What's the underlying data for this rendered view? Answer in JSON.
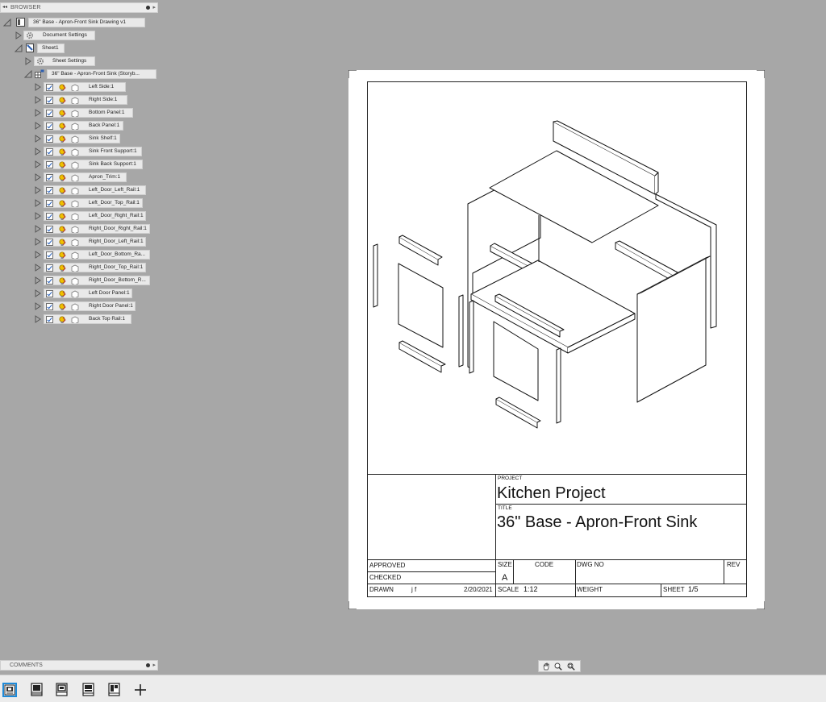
{
  "browser": {
    "title": "BROWSER",
    "root": "36\" Base - Apron-Front Sink Drawing v1",
    "document_settings": "Document Settings",
    "sheet": "Sheet1",
    "sheet_settings": "Sheet Settings",
    "view": "36\" Base - Apron-Front Sink (Storyb...",
    "components": [
      "Left Side:1",
      "Right Side:1",
      "Bottom Panel:1",
      "Back Panel:1",
      "Sink Shelf:1",
      "Sink Front Support:1",
      "Sink Back Support:1",
      "Apron_Trim:1",
      "Left_Door_Left_Rail:1",
      "Left_Door_Top_Rail:1",
      "Left_Door_Right_Rail:1",
      "Right_Door_Right_Rail:1",
      "Right_Door_Left_Rail:1",
      "Left_Door_Bottom_Ra...",
      "Right_Door_Top_Rail:1",
      "Right_Door_Bottom_R...",
      "Left Door Panel:1",
      "Right Door Panel:1",
      "Back Top Rail:1"
    ]
  },
  "comments": {
    "title": "COMMENTS"
  },
  "title_block": {
    "project_label": "PROJECT",
    "project": "Kitchen Project",
    "title_label": "TITLE",
    "title": "36\" Base - Apron-Front Sink",
    "approved_label": "APPROVED",
    "checked_label": "CHECKED",
    "drawn_label": "DRAWN",
    "drawn_by": "j f",
    "date": "2/20/2021",
    "size_label": "SIZE",
    "size": "A",
    "code_label": "CODE",
    "dwg_no_label": "DWG NO",
    "rev_label": "REV",
    "scale_label": "SCALE",
    "scale": "1:12",
    "weight_label": "WEIGHT",
    "sheet_label": "SHEET",
    "sheet": "1/5"
  },
  "colors": {
    "canvas": "#a7a7a7",
    "panel": "#ececec",
    "accent": "#1f8ad8",
    "check": "#1b57b8"
  },
  "icons": {
    "navbar": [
      "pan-icon",
      "zoom-icon",
      "zoom-window-icon"
    ],
    "sheet_tabs": [
      "sheet-1-icon",
      "sheet-2-icon",
      "sheet-3-icon",
      "sheet-4-icon",
      "sheet-5-icon",
      "add-sheet-icon"
    ]
  }
}
